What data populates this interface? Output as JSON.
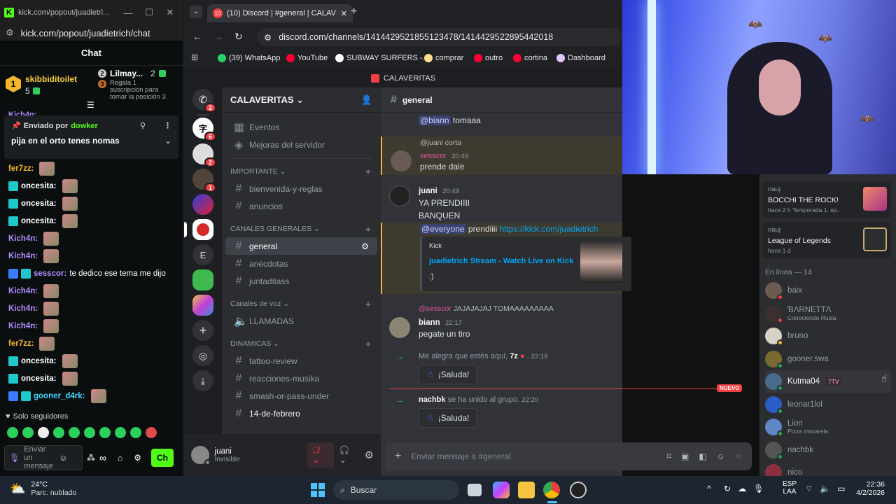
{
  "kick": {
    "window_title": "kick.com/popout/juadietri...",
    "url": "kick.com/popout/juadietrich/chat",
    "chat_header": "Chat",
    "gift1": {
      "user": "skibbiditoilet",
      "count": "5",
      "rank": "1"
    },
    "gift2": {
      "user": "Lilmay...",
      "count": "2",
      "rank": "2",
      "rank3": "3",
      "text": "Regala 1 suscripción para tomar la posición 3"
    },
    "partial_user": "Kich4n:",
    "pinned": {
      "prefix": "Enviado por",
      "author": "dowker",
      "text": "pija en el orto tenes nomas"
    },
    "messages": [
      {
        "user": "fer7zz:",
        "color": "#f5b72a",
        "badge": "",
        "text": ""
      },
      {
        "user": "oncesita:",
        "color": "#ffffff",
        "badge": "b",
        "text": ""
      },
      {
        "user": "oncesita:",
        "color": "#ffffff",
        "badge": "b",
        "text": ""
      },
      {
        "user": "oncesita:",
        "color": "#ffffff",
        "badge": "b",
        "text": ""
      },
      {
        "user": "Kich4n:",
        "color": "#b18cff",
        "badge": "",
        "text": ""
      },
      {
        "user": "Kich4n:",
        "color": "#b18cff",
        "badge": "",
        "text": ""
      },
      {
        "user": "sesscor:",
        "color": "#b18cff",
        "badge": "bb",
        "text": "te dedico ese tema me dijo"
      },
      {
        "user": "Kich4n:",
        "color": "#b18cff",
        "badge": "",
        "text": ""
      },
      {
        "user": "Kich4n:",
        "color": "#b18cff",
        "badge": "",
        "text": ""
      },
      {
        "user": "Kich4n:",
        "color": "#b18cff",
        "badge": "",
        "text": ""
      },
      {
        "user": "fer7zz:",
        "color": "#f5b72a",
        "badge": "",
        "text": ""
      },
      {
        "user": "oncesita:",
        "color": "#ffffff",
        "badge": "b",
        "text": ""
      },
      {
        "user": "oncesita:",
        "color": "#ffffff",
        "badge": "b",
        "text": ""
      },
      {
        "user": "gooner_d4rk:",
        "color": "#3dd6ff",
        "badge": "bb",
        "text": ""
      }
    ],
    "followers_only": "Solo seguidores",
    "send_placeholder": "Enviar un mensaje",
    "chat_button": "Ch"
  },
  "browser": {
    "tab_title": "(10) Discord | #general | CALAV",
    "tab_badge": "10",
    "url": "discord.com/channels/1414429521855123478/1414429522895442018",
    "bookmarks": [
      {
        "label": "(39) WhatsApp",
        "color": "#25d366"
      },
      {
        "label": "YouTube",
        "color": "#ff0033"
      },
      {
        "label": "SUBWAY SURFERS -...",
        "color": "#ffffff"
      },
      {
        "label": "comprar",
        "color": "#ffe08a"
      },
      {
        "label": "outro",
        "color": "#ff0033"
      },
      {
        "label": "cortina",
        "color": "#ff0033"
      },
      {
        "label": "Dashboard",
        "color": "#e0c3ff"
      }
    ]
  },
  "discord": {
    "server_banner": "CALAVERITAS",
    "server_name": "CALAVERITAS",
    "rail_badges": [
      "2",
      "6",
      "2",
      "1"
    ],
    "rail_letter": "E",
    "top_items": [
      "Eventos",
      "Mejoras del servidor"
    ],
    "categories": [
      {
        "name": "IMPORTANTE",
        "channels": [
          "bienvenida-y-reglas",
          "anuncios"
        ]
      },
      {
        "name": "CANALES GENERALES",
        "channels": [
          "general",
          "anécdotas",
          "juntaditass"
        ]
      },
      {
        "name": "Canales de voz",
        "channels": [
          "LLAMADAS"
        ]
      },
      {
        "name": "DINAMICAS",
        "channels": [
          "tattoo-review",
          "reacciones-musika",
          "smash-or-pass-under",
          "14-de-febrero"
        ]
      }
    ],
    "current_channel": "general",
    "user": {
      "name": "juani",
      "status": "Invisible"
    },
    "messages": {
      "m1_mention": "@biann",
      "m1_text": "tomaaa",
      "m2_reply_to": "@juani corta",
      "m2_author": "sesscor",
      "m2_time": "20:49",
      "m2_text": "prende dale",
      "m3_author": "juani",
      "m3_time": "20:49",
      "m3_line1": "YA PRENDIIII",
      "m3_line2": "BANQUEN",
      "m3_mention": "@everyone",
      "m3_text": "prendiiii",
      "m3_link": "https://kick.com/juadietrich",
      "embed_provider": "Kick",
      "embed_title": "juadietrich Stream - Watch Live on Kick",
      "embed_desc": ":)",
      "m4_reply_to": "@sesscor",
      "m4_reply_text": "JAJAJAJAJ TOMAAAAAAAAA",
      "m4_author": "biann",
      "m4_time": "22:17",
      "m4_text": "pegate un tiro",
      "join1_text": "Me alegra que estés aquí,",
      "join1_user": "7z",
      "join1_time": "22:19",
      "saluda": "¡Saluda!",
      "new_label": "NUEVO",
      "join2_user": "nachbk",
      "join2_text": "se ha unido al grupo.",
      "join2_time": "22:20",
      "composer_placeholder": "Enviar mensaje a #general"
    },
    "activities": [
      {
        "user": "nauj",
        "title": "BOCCHI THE ROCK!",
        "meta": "hace 2 h  Temporada 1, ep..."
      },
      {
        "user": "nauj",
        "title": "League of Legends",
        "meta": "hace 1 d"
      }
    ],
    "online_header": "En línea — 14",
    "members": [
      {
        "name": "baix",
        "sub": "",
        "status": "#f23f43",
        "avatar": "#6b5b50"
      },
      {
        "name": "ƁΛRNETTΛ",
        "sub": "Conociendo Rusia",
        "status": "#f23f43",
        "avatar": "#3b3030"
      },
      {
        "name": "bruno",
        "sub": "",
        "status": "#f0b232",
        "avatar": "#d8d2c4"
      },
      {
        "name": "gooner.swa",
        "sub": "",
        "status": "#23a55a",
        "avatar": "#7a6a30"
      },
      {
        "name": "Kutma04",
        "sub": "",
        "status": "#23a55a",
        "avatar": "#4a6a8a",
        "tag": "7TV"
      },
      {
        "name": "leonar1lol",
        "sub": "",
        "status": "#23a55a",
        "avatar": "#2b5cc8"
      },
      {
        "name": "Lion",
        "sub": "Pizza mozarela",
        "status": "#23a55a",
        "avatar": "#5f86c5"
      },
      {
        "name": "nachbk",
        "sub": "",
        "status": "#23a55a",
        "avatar": "#555"
      },
      {
        "name": "nico",
        "sub": "",
        "status": "#f23f43",
        "avatar": "#8a3040"
      }
    ]
  },
  "taskbar": {
    "weather_temp": "24°C",
    "weather_desc": "Parc. nublado",
    "search": "Buscar",
    "lang1": "ESP",
    "lang2": "LAA",
    "time": "22:36",
    "date": "4/2/2026"
  }
}
